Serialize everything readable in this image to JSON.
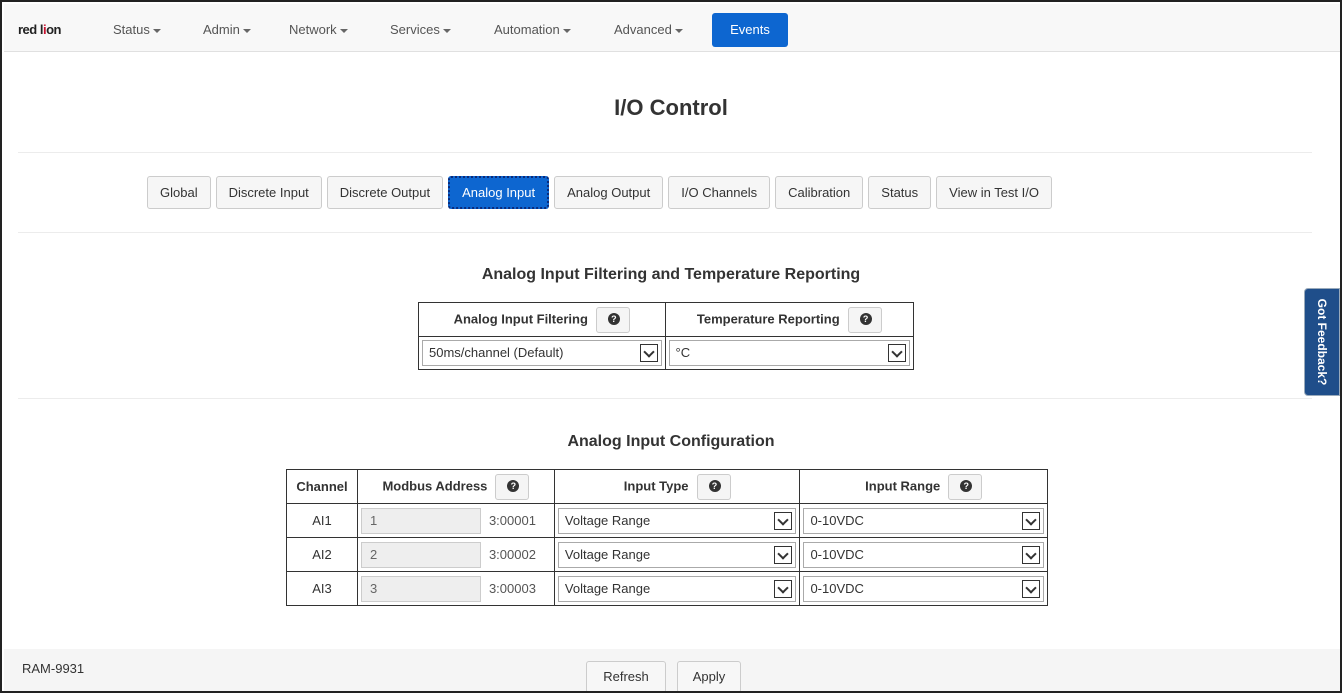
{
  "navbar": {
    "logo": {
      "pre": "red l",
      "o": "i",
      "post": "on"
    },
    "items": [
      "Status",
      "Admin",
      "Network",
      "Services",
      "Automation",
      "Advanced"
    ],
    "active": "Events"
  },
  "page": {
    "title": "I/O Control"
  },
  "tabs": [
    "Global",
    "Discrete Input",
    "Discrete Output",
    "Analog Input",
    "Analog Output",
    "I/O Channels",
    "Calibration",
    "Status",
    "View in Test I/O"
  ],
  "active_tab": "Analog Input",
  "filtering": {
    "title": "Analog Input Filtering and Temperature Reporting",
    "filter_header": "Analog Input Filtering",
    "temp_header": "Temperature Reporting",
    "filter_value": "50ms/channel (Default)",
    "temp_value": "°C"
  },
  "config": {
    "title": "Analog Input Configuration",
    "headers": {
      "channel": "Channel",
      "modbus": "Modbus Address",
      "type": "Input Type",
      "range": "Input Range"
    },
    "rows": [
      {
        "channel": "AI1",
        "offset": "1",
        "address": "3:00001",
        "type": "Voltage Range",
        "range": "0-10VDC"
      },
      {
        "channel": "AI2",
        "offset": "2",
        "address": "3:00002",
        "type": "Voltage Range",
        "range": "0-10VDC"
      },
      {
        "channel": "AI3",
        "offset": "3",
        "address": "3:00003",
        "type": "Voltage Range",
        "range": "0-10VDC"
      }
    ]
  },
  "feedback": "Got Feedback?",
  "footer": {
    "device": "RAM-9931",
    "refresh": "Refresh",
    "apply": "Apply"
  },
  "colors": {
    "primary": "#0d66d0",
    "feedback": "#1f4e8a",
    "logo_accent": "#c8102e"
  }
}
